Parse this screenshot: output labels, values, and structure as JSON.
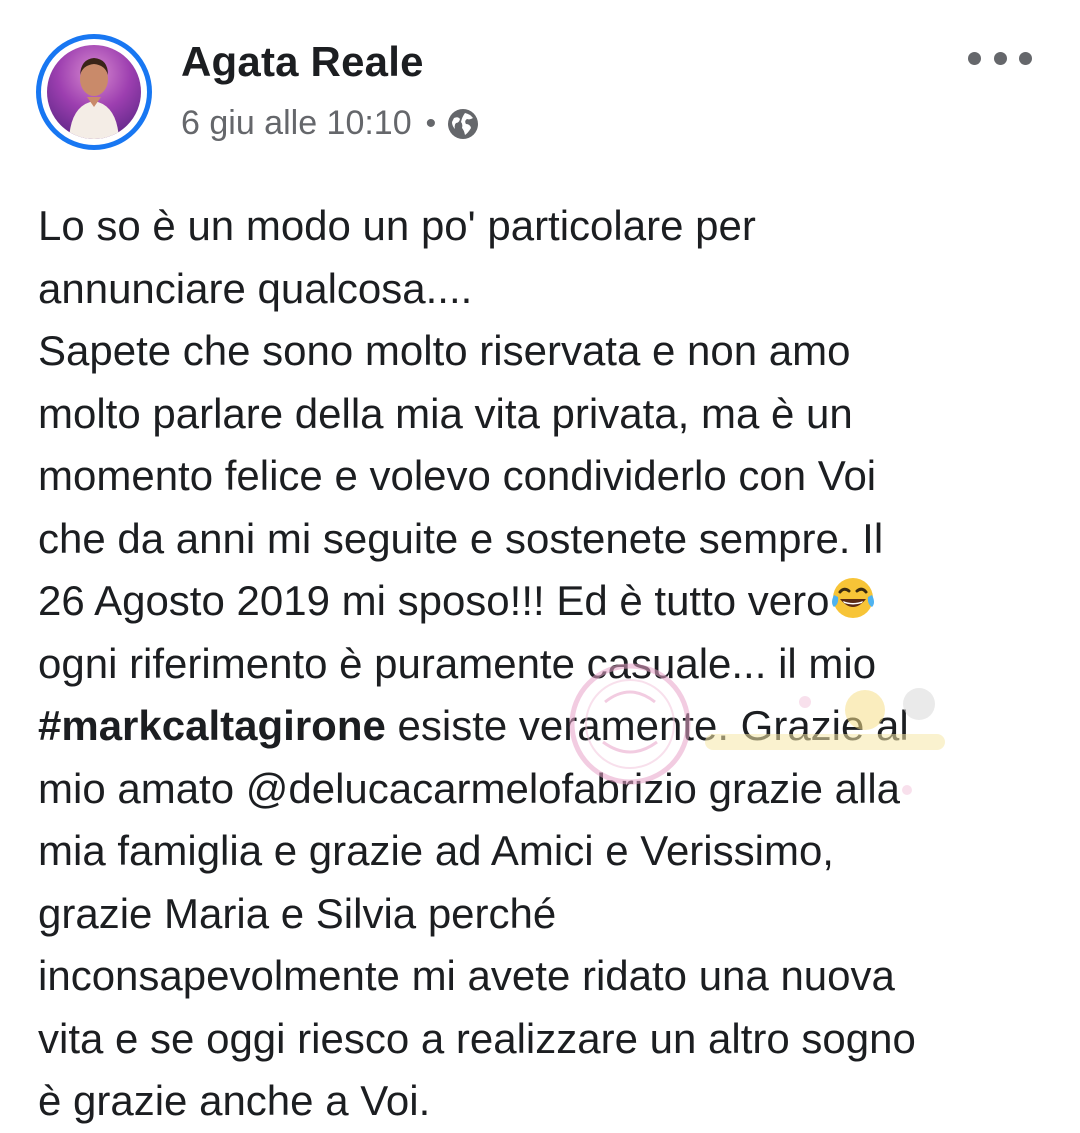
{
  "post": {
    "author": "Agata Reale",
    "timestamp": "6 giu alle 10:10",
    "separator": "•",
    "privacy_icon": "globe-icon",
    "more_icon": "more-options-icon",
    "avatar_icon": "profile-photo",
    "body": {
      "line1": "Lo so è un modo un po' particolare per",
      "line2": "annunciare qualcosa....",
      "line3": "Sapete che sono molto riservata e non amo",
      "line4": "molto parlare della mia vita privata, ma è un",
      "line5": "momento felice e volevo condividerlo con Voi",
      "line6": "che da anni mi seguite e sostenete sempre. Il",
      "line7": "26 Agosto 2019 mi sposo!!! Ed è tutto vero",
      "line7_emoji": "face-with-tears-of-joy",
      "line8": "ogni riferimento è puramente casuale... il mio",
      "line9_hashtag": "#markcaltagirone",
      "line9_rest": " esiste veramente. Grazie al",
      "line10": "mio amato @delucacarmelofabrizio grazie alla",
      "line11": "mia famiglia e grazie ad Amici e Verissimo,",
      "line12": "grazie Maria e Silvia perché",
      "line13": "inconsapevolmente mi avete ridato una nuova",
      "line14": "vita e se oggi riesco a realizzare un altro sogno",
      "line15": "è grazie anche a Voi."
    }
  },
  "colors": {
    "accent": "#1877f2",
    "text": "#1c1e21",
    "secondary_text": "#65676b"
  }
}
